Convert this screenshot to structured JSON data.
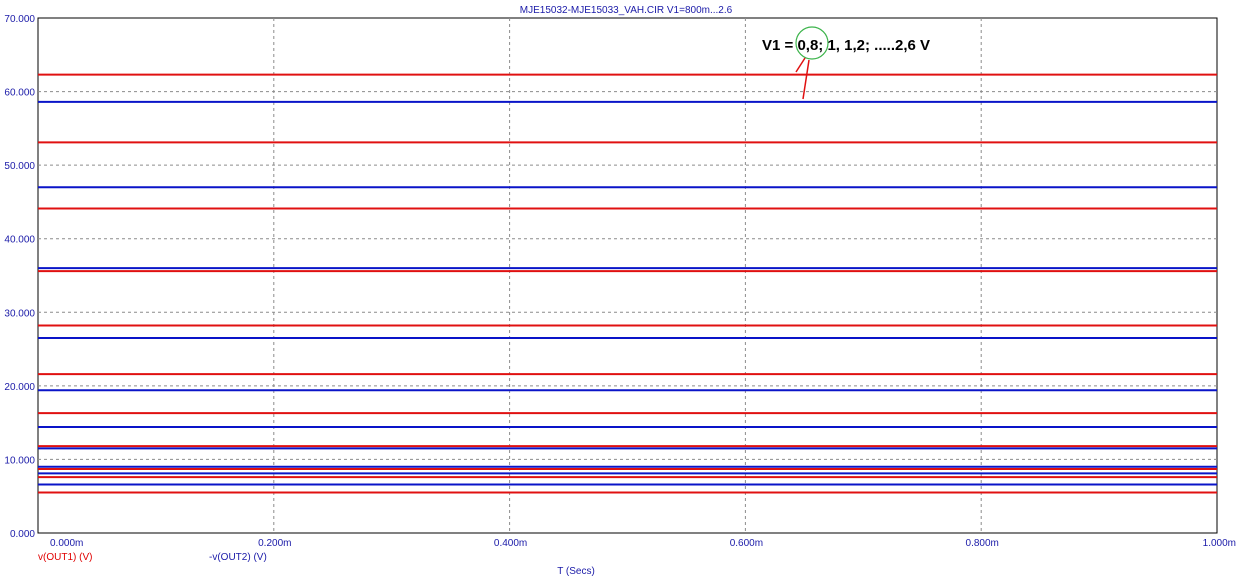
{
  "window": {
    "title": "MJE15032-MJE15033_VAH.CIR V1=800m...2.6"
  },
  "colors": {
    "series1": "#e01010",
    "series2": "#0a14c8",
    "axis_text": "#1a1aa8",
    "grid": "#8c8c8c",
    "annotation_circle": "#3cb44b"
  },
  "annotation": {
    "text": "V1 = 0,8; 1, 1,2; .....2,6 V"
  },
  "chart_data": {
    "type": "line",
    "title": "MJE15032-MJE15033_VAH.CIR V1=800m...2.6",
    "xlabel": "T (Secs)",
    "ylabel": "",
    "xlim": [
      0,
      1.0
    ],
    "ylim": [
      0,
      70
    ],
    "x_ticks": [
      "0.000m",
      "0.200m",
      "0.400m",
      "0.600m",
      "0.800m",
      "1.000m"
    ],
    "y_ticks": [
      "0.000",
      "10.000",
      "20.000",
      "30.000",
      "40.000",
      "50.000",
      "60.000",
      "70.000"
    ],
    "grid": true,
    "x": [
      0.0,
      1.0
    ],
    "series": [
      {
        "name": "v(OUT1) (V)",
        "color": "red",
        "values": [
          5.5,
          7.6,
          8.7,
          11.8,
          16.3,
          21.6,
          28.2,
          35.6,
          44.1,
          53.1,
          62.3
        ]
      },
      {
        "name": "-v(OUT2) (V)",
        "color": "blue",
        "values": [
          6.6,
          8.1,
          9.0,
          11.5,
          14.4,
          19.4,
          26.5,
          36.0,
          47.0,
          58.6
        ]
      }
    ]
  }
}
